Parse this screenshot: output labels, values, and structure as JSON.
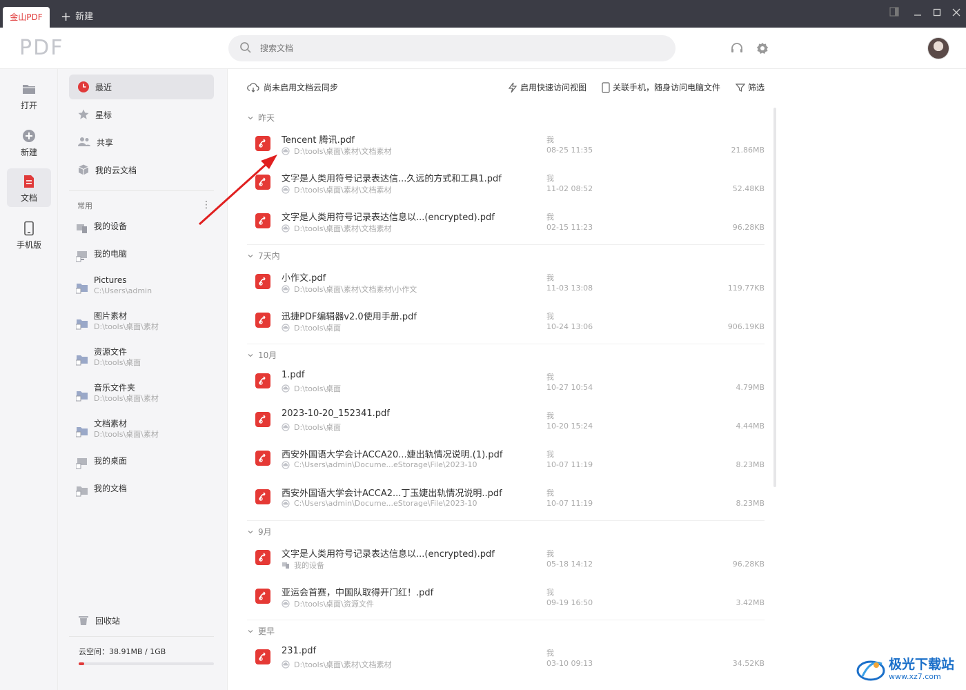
{
  "titlebar": {
    "active_tab": "金山PDF",
    "new_tab": "新建"
  },
  "header": {
    "logo": "PDF",
    "search_placeholder": "搜索文档"
  },
  "rail": [
    {
      "label": "打开",
      "icon": "folder-icon"
    },
    {
      "label": "新建",
      "icon": "plus-circle-icon"
    },
    {
      "label": "文档",
      "icon": "document-icon",
      "active": true
    },
    {
      "label": "手机版",
      "icon": "phone-icon"
    }
  ],
  "nav": {
    "items": [
      {
        "label": "最近",
        "icon": "clock-icon",
        "active": true
      },
      {
        "label": "星标",
        "icon": "star-icon"
      },
      {
        "label": "共享",
        "icon": "people-icon"
      },
      {
        "label": "我的云文档",
        "icon": "cloud-box-icon"
      }
    ],
    "group_label": "常用",
    "devices": [
      {
        "name": "我的设备",
        "path": ""
      },
      {
        "name": "我的电脑",
        "path": ""
      },
      {
        "name": "Pictures",
        "path": "C:\\Users\\admin"
      },
      {
        "name": "图片素材",
        "path": "D:\\tools\\桌面\\素材"
      },
      {
        "name": "资源文件",
        "path": "D:\\tools\\桌面"
      },
      {
        "name": "音乐文件夹",
        "path": "D:\\tools\\桌面\\素材"
      },
      {
        "name": "文档素材",
        "path": "D:\\tools\\桌面\\素材"
      },
      {
        "name": "我的桌面",
        "path": ""
      },
      {
        "name": "我的文档",
        "path": ""
      }
    ],
    "trash": "回收站",
    "storage": "云空间：38.91MB / 1GB",
    "storage_fraction": 0.038
  },
  "toolbar": {
    "sync": "尚未启用文档云同步",
    "quick_view": "启用快速访问视图",
    "phone": "关联手机，随身访问电脑文件",
    "filter": "筛选"
  },
  "groups": [
    {
      "label": "昨天",
      "files": [
        {
          "name": "Tencent 腾讯.pdf",
          "path": "D:\\tools\\桌面\\素材\\文档素材",
          "owner": "我",
          "time": "08-25 11:35",
          "size": "21.86MB"
        },
        {
          "name": "文字是人类用符号记录表达信...久远的方式和工具1.pdf",
          "path": "D:\\tools\\桌面\\素材\\文档素材",
          "owner": "我",
          "time": "11-02 08:52",
          "size": "52.48KB"
        },
        {
          "name": "文字是人类用符号记录表达信息以...(encrypted).pdf",
          "path": "D:\\tools\\桌面\\素材\\文档素材",
          "owner": "我",
          "time": "02-15 11:23",
          "size": "96.28KB"
        }
      ]
    },
    {
      "label": "7天内",
      "files": [
        {
          "name": "小作文.pdf",
          "path": "D:\\tools\\桌面\\素材\\文档素材\\小作文",
          "owner": "我",
          "time": "11-03 13:08",
          "size": "119.77KB"
        },
        {
          "name": "迅捷PDF编辑器v2.0使用手册.pdf",
          "path": "D:\\tools\\桌面",
          "owner": "我",
          "time": "10-24 13:06",
          "size": "906.19KB"
        }
      ]
    },
    {
      "label": "10月",
      "files": [
        {
          "name": "1.pdf",
          "path": "D:\\tools\\桌面",
          "owner": "我",
          "time": "10-27 10:54",
          "size": "4.79MB"
        },
        {
          "name": "2023-10-20_152341.pdf",
          "path": "D:\\tools\\桌面",
          "owner": "我",
          "time": "10-20 15:24",
          "size": "4.44MB"
        },
        {
          "name": "西安外国语大学会计ACCA20...婕出轨情况说明.(1).pdf",
          "path": "C:\\Users\\admin\\Docume...eStorage\\File\\2023-10",
          "owner": "我",
          "time": "10-07 11:19",
          "size": "8.23MB"
        },
        {
          "name": "西安外国语大学会计ACCA2...丁玉婕出轨情况说明..pdf",
          "path": "C:\\Users\\admin\\Docume...eStorage\\File\\2023-10",
          "owner": "我",
          "time": "10-07 11:19",
          "size": "8.23MB"
        }
      ]
    },
    {
      "label": "9月",
      "files": [
        {
          "name": "文字是人类用符号记录表达信息以...(encrypted).pdf",
          "path": "我的设备",
          "owner": "我",
          "time": "05-18 14:12",
          "size": "96.28KB"
        },
        {
          "name": "亚运会首赛，中国队取得开门红！.pdf",
          "path": "D:\\tools\\桌面\\资源文件",
          "owner": "我",
          "time": "09-19 16:50",
          "size": "3.42MB"
        }
      ]
    },
    {
      "label": "更早",
      "files": [
        {
          "name": "231.pdf",
          "path": "D:\\tools\\桌面\\素材\\文档素材",
          "owner": "我",
          "time": "03-10 09:13",
          "size": "34.52KB"
        }
      ]
    }
  ],
  "watermark": {
    "line1": "极光下载站",
    "line2": "www.xz7.com"
  },
  "colors": {
    "accent": "#e03a3a",
    "pdf_icon": "#e53935",
    "titlebar": "#3b3c45"
  }
}
